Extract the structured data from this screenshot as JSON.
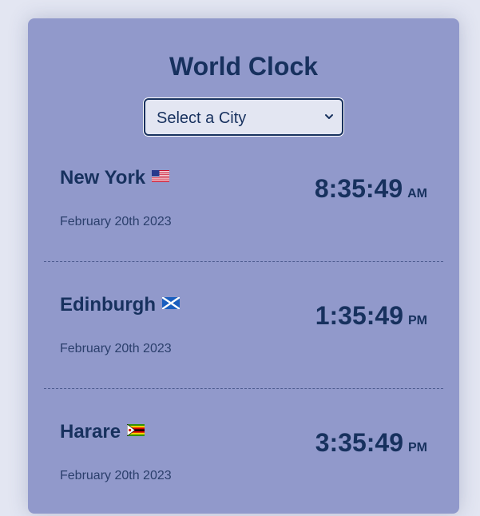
{
  "app": {
    "title": "World Clock"
  },
  "city_select": {
    "selected": "Select a City"
  },
  "cities": [
    {
      "name": "New York",
      "flag": "us-flag-icon",
      "date": "February 20th 2023",
      "time": "8:35:49",
      "ampm": "AM"
    },
    {
      "name": "Edinburgh",
      "flag": "scotland-flag-icon",
      "date": "February 20th 2023",
      "time": "1:35:49",
      "ampm": "PM"
    },
    {
      "name": "Harare",
      "flag": "zimbabwe-flag-icon",
      "date": "February 20th 2023",
      "time": "3:35:49",
      "ampm": "PM"
    }
  ],
  "colors": {
    "page_background": "#e3e6f2",
    "card_background": "#9199cb",
    "text": "#17315e",
    "divider": "#4d5b8f"
  }
}
